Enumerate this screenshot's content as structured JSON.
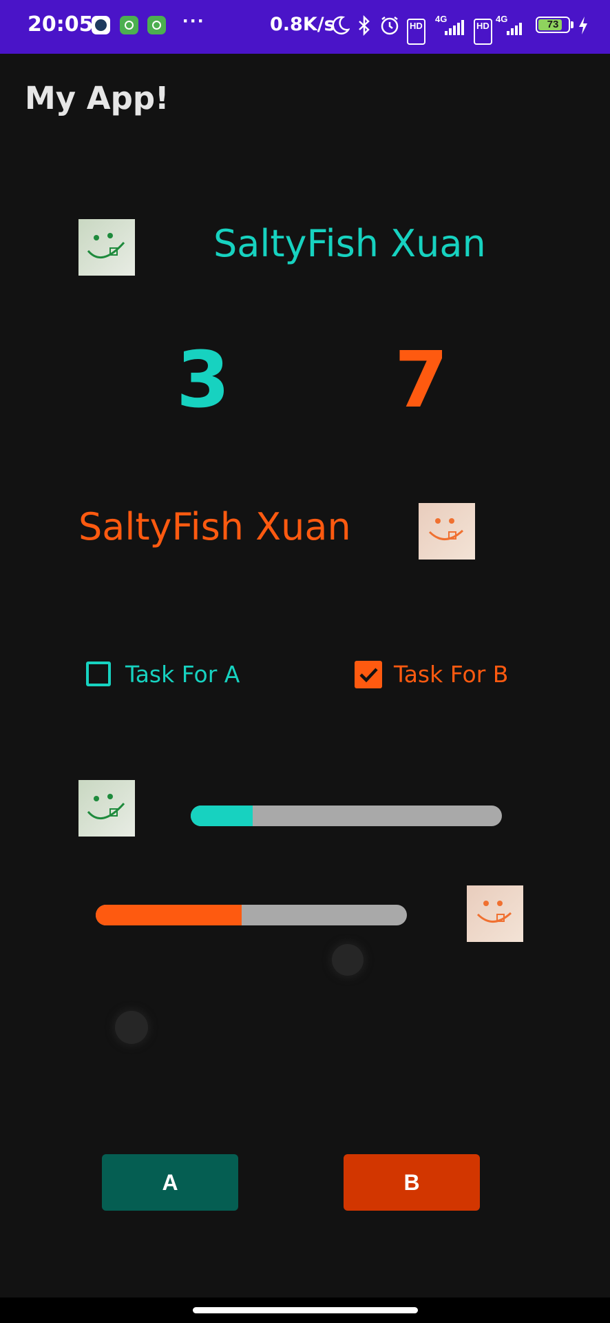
{
  "status_bar": {
    "time": "20:05",
    "more": "···",
    "net_speed": "0.8K/s",
    "icons": [
      "app-icon-1",
      "app-icon-2",
      "app-icon-3",
      "moon-icon",
      "bluetooth-icon",
      "alarm-icon",
      "hd-icon",
      "4g-signal-icon",
      "hd-icon",
      "4g-signal-icon",
      "battery-icon",
      "charging-icon"
    ],
    "hd": "HD",
    "net": "4G",
    "battery": "73"
  },
  "app_bar": {
    "title": "My App!"
  },
  "player_a": {
    "name": "SaltyFish Xuan",
    "score": "3",
    "task_label": "Task For A",
    "task_checked": false,
    "progress": 0.2,
    "color": "#17d2c0",
    "button_label": "A",
    "button_color": "#055e52"
  },
  "player_b": {
    "name": "SaltyFish Xuan",
    "score": "7",
    "task_label": "Task For B",
    "task_checked": true,
    "progress": 0.47,
    "color": "#fe5a10",
    "button_label": "B",
    "button_color": "#d23600"
  }
}
